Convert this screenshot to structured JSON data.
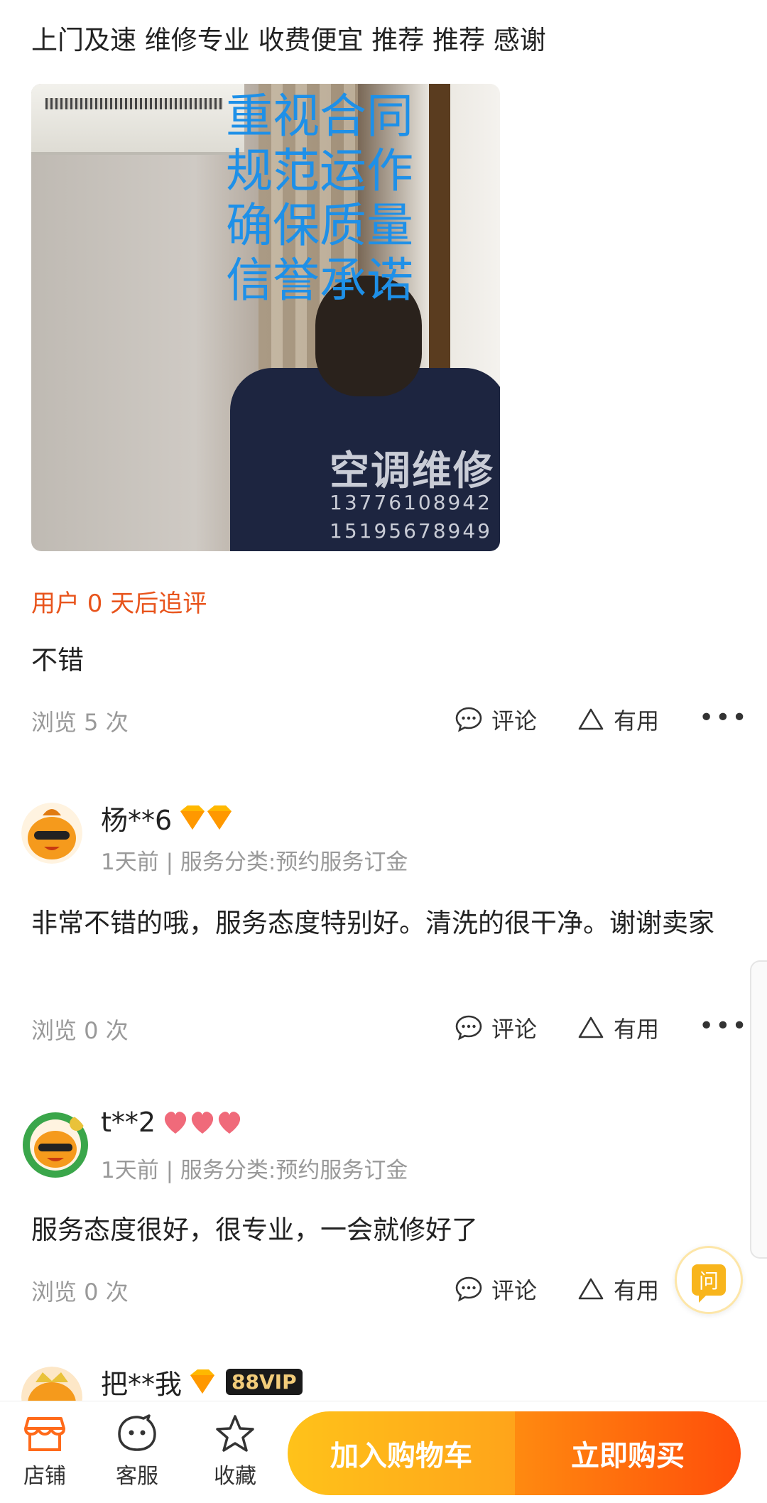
{
  "review1": {
    "text": "上门及速 维修专业 收费便宜 推荐 推荐 感谢",
    "photo_overlay": [
      "重视合同",
      "规范运作",
      "确保质量",
      "信誉承诺"
    ],
    "shirt_text": "空调维修",
    "shirt_numbers": [
      "13776108942",
      "15195678949"
    ],
    "followup_label": "用户 0 天后追评",
    "followup_text": "不错",
    "views": "浏览 5 次"
  },
  "actions": {
    "comment_label": "评论",
    "useful_label": "有用",
    "more_label": "•••"
  },
  "review2": {
    "username": "杨**6",
    "meta": "1天前 | 服务分类:预约服务订金",
    "text": "非常不错的哦，服务态度特别好。清洗的很干净。谢谢卖家",
    "views": "浏览 0 次"
  },
  "review3": {
    "username": "t**2",
    "meta": "1天前 | 服务分类:预约服务订金",
    "text": "服务态度很好，很专业，一会就修好了",
    "views": "浏览 0 次"
  },
  "review4": {
    "username": "把**我",
    "vip_badge": "88VIP"
  },
  "ask_button": {
    "label": "问"
  },
  "bottom_bar": {
    "store_label": "店铺",
    "service_label": "客服",
    "favorite_label": "收藏",
    "add_to_cart_label": "加入购物车",
    "buy_now_label": "立即购买"
  },
  "colors": {
    "accent_orange": "#e8541c",
    "overlay_blue": "#1e90e8",
    "cart_yellow": "#ffc21a",
    "buy_orange": "#ff4e0a"
  }
}
